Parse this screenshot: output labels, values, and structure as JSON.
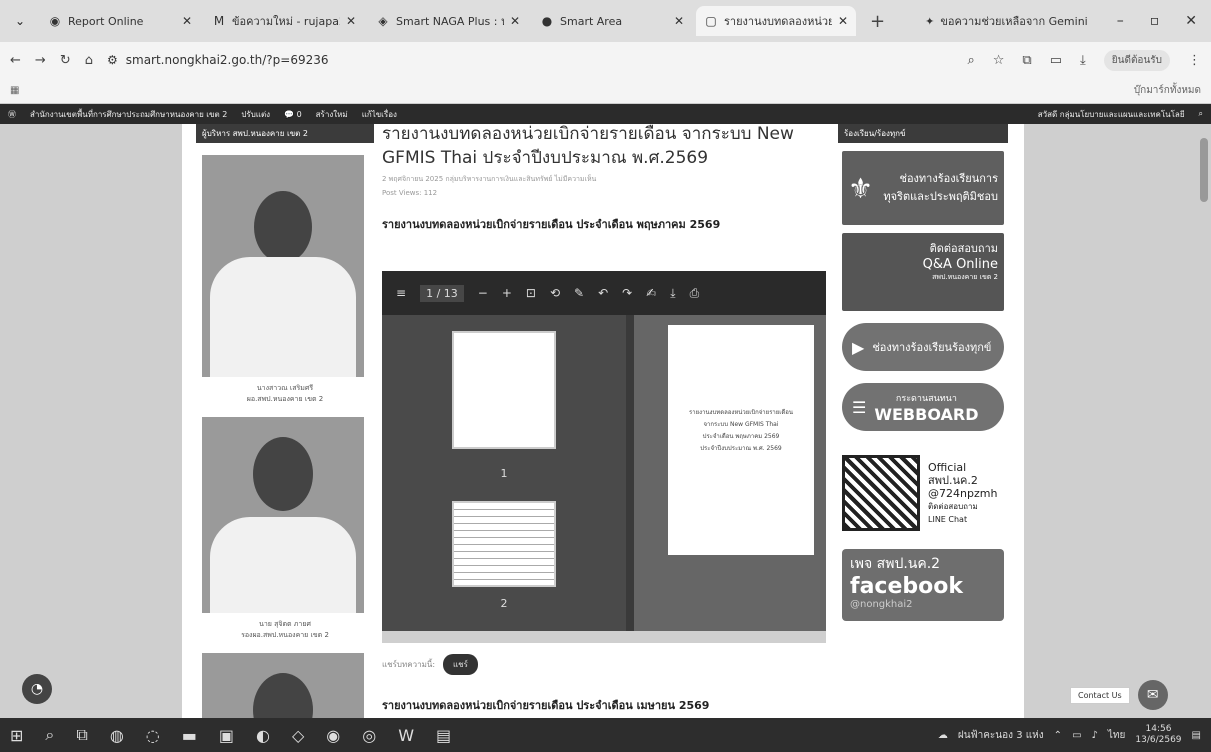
{
  "browser": {
    "tabs": [
      {
        "label": "Report Online",
        "icon": "globe-icon"
      },
      {
        "label": "ข้อความใหม่ - rujapa21",
        "icon": "gmail-icon"
      },
      {
        "label": "Smart NAGA Plus : นำ",
        "icon": "naga-icon"
      },
      {
        "label": "Smart Area",
        "icon": "smart-area-icon"
      },
      {
        "label": "รายงานงบทดลองหน่วยเบิกจ่าย",
        "icon": "page-icon",
        "active": true
      }
    ],
    "gemini_label": "ขอความช่วยเหลือจาก Gemini",
    "url": "smart.nongkhai2.go.th/?p=69236",
    "profile_label": "ยินดีต้อนรับ",
    "bookmarks_all": "บุ๊กมาร์กทั้งหมด"
  },
  "wpbar": {
    "site_name": "สำนักงานเขตพื้นที่การศึกษาประถมศึกษาหนองคาย เขต 2",
    "customize": "ปรับแต่ง",
    "comments": "0",
    "new": "สร้างใหม่",
    "edit": "แก้ไขเรื่อง",
    "greeting": "สวัสดี กลุ่มนโยบายและแผนและเทคโนโลยี"
  },
  "left_col": {
    "header": "ผู้บริหาร สพป.หนองคาย เขต 2",
    "people": [
      {
        "name": "นางสาวณ เสริมศรี",
        "title": "ผอ.สพป.หนองคาย เขต 2"
      },
      {
        "name": "นาย สุจิตต ภายศ",
        "title": "รองผอ.สพป.หนองคาย เขต 2"
      }
    ]
  },
  "main": {
    "title": "รายงานงบทดลองหน่วยเบิกจ่ายรายเดือน จากระบบ New GFMIS Thai ประจำปีงบประมาณ พ.ศ.2569",
    "meta": "2 พฤศจิกายน 2025  กลุ่มบริหารงานการเงินและสินทรัพย์  ไม่มีความเห็น",
    "views": "Post Views: 112",
    "section1": "รายงานงบทดลองหน่วยเบิกจ่ายรายเดือน ประจำเดือน พฤษภาคม 2569",
    "viewer": {
      "page": "1",
      "total": "/ 13",
      "thumb1": "1",
      "thumb2": "2",
      "doc_lines": [
        "รายงานงบทดลองหน่วยเบิกจ่ายรายเดือน",
        "จากระบบ New GFMIS Thai",
        "ประจำเดือน พฤษภาคม 2569",
        "ประจำปีงบประมาณ พ.ศ. 2569"
      ]
    },
    "share_label": "แชร์บทความนี้:",
    "share_btn": "แชร์",
    "section2": "รายงานงบทดลองหน่วยเบิกจ่ายรายเดือน ประจำเดือน เมษายน 2569"
  },
  "right_col": {
    "header": "ร้องเรียน/ร้องทุกข์",
    "b1": "ช่องทางร้องเรียนการทุจริตและประพฤติมิชอบ",
    "b2a": "ติดต่อสอบถาม",
    "b2b": "Q&A Online",
    "b2c": "สพป.หนองคาย เขต 2",
    "b3": "ช่องทางร้องเรียนร้องทุกข์",
    "b4a": "กระดานสนทนา",
    "b4b": "WEBBOARD",
    "qr": [
      "Official",
      "สพป.นค.2",
      "@724npzmh",
      "ติดต่อสอบถาม",
      "LINE Chat"
    ],
    "fb_a": "เพจ สพป.นค.2",
    "fb_b": "facebook",
    "fb_c": "@nongkhai2"
  },
  "contact_label": "Contact Us",
  "taskbar": {
    "weather": "ฝนฟ้าคะนอง 3 แห่ง",
    "lang": "ไทย",
    "time": "14:56",
    "date": "13/6/2569"
  }
}
